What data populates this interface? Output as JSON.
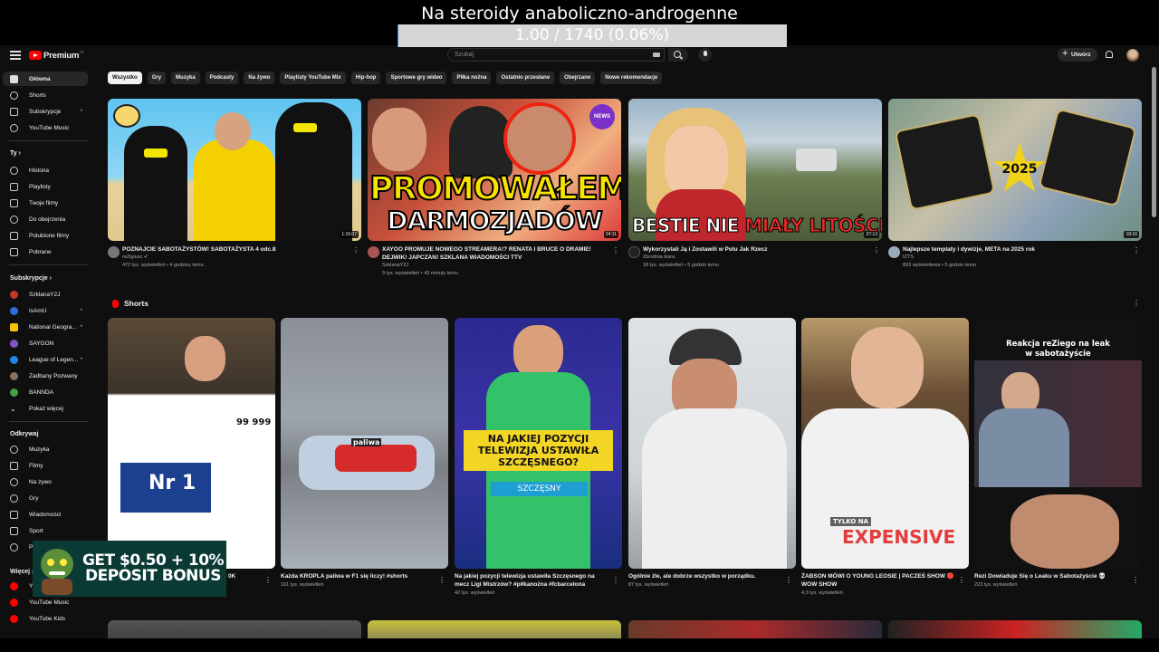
{
  "overlay": {
    "title": "Na steroidy anaboliczno-androgenne",
    "progress_text": "1.00 / 1740 (0.06%)",
    "progress_fraction": 0.0006
  },
  "header": {
    "logo_text": "Premium",
    "logo_sup": "PL",
    "search_placeholder": "Szukaj",
    "create_label": "Utwórz"
  },
  "sidebar": {
    "main": [
      {
        "label": "Główna"
      },
      {
        "label": "Shorts"
      },
      {
        "label": "Subskrypcje"
      },
      {
        "label": "YouTube Music"
      }
    ],
    "you_header": "Ty",
    "you": [
      {
        "label": "Historia"
      },
      {
        "label": "Playlisty"
      },
      {
        "label": "Twoje filmy"
      },
      {
        "label": "Do obejrzenia"
      },
      {
        "label": "Polubione filmy"
      },
      {
        "label": "Pobrane"
      }
    ],
    "subs_header": "Subskrypcje",
    "subs": [
      {
        "label": "SzklanaY2J"
      },
      {
        "label": "IsAmU"
      },
      {
        "label": "National Geogra..."
      },
      {
        "label": "SAYGON"
      },
      {
        "label": "League of Legen..."
      },
      {
        "label": "Zadbany Pozwany"
      },
      {
        "label": "BANNDA"
      },
      {
        "label": "Pokaż więcej"
      }
    ],
    "explore_header": "Odkrywaj",
    "explore": [
      {
        "label": "Muzyka"
      },
      {
        "label": "Filmy"
      },
      {
        "label": "Na żywo"
      },
      {
        "label": "Gry"
      },
      {
        "label": "Wiadomości"
      },
      {
        "label": "Sport"
      },
      {
        "label": "P"
      }
    ],
    "more_header": "Więcej z",
    "more": [
      {
        "label": "Y"
      },
      {
        "label": "YouTube Music"
      },
      {
        "label": "YouTube Kids"
      }
    ]
  },
  "chips": [
    "Wszystko",
    "Gry",
    "Muzyka",
    "Podcasty",
    "Na żywo",
    "Playlisty YouTube Mix",
    "Hip-hop",
    "Sportowe gry wideo",
    "Piłka nożna",
    "Ostatnio przesłane",
    "Obejrzane",
    "Nowe rekomendacje"
  ],
  "videos": [
    {
      "title": "POZNAJCIE SABOTAŻYSTÓW! SABOTAŻYSTA 4 odc.8",
      "channel": "reZigiusz ✔",
      "stats": "472 tys. wyświetleń • 4 godziny temu",
      "duration": "1:16:07",
      "thumb_text": ""
    },
    {
      "title": "XAYOO PROMUJE NOWEGO STREAMERA!? RENATA I BRUCE O DRAMIE! DEJWIK! JAPCZAN! SZKLANA WIADOMOŚCI TTV",
      "channel": "SzklanaY2J",
      "stats": "9 tys. wyświetleń • 43 minuty temu",
      "duration": "24:11",
      "thumb_text": "PROMOWAŁEM! DARMOZJADÓW"
    },
    {
      "title": "Wykorzystali Ją i Zostawili w Polu Jak Rzecz",
      "channel": "Zbrodnia ikara",
      "stats": "18 tys. wyświetleń • 5 godzin temu",
      "duration": "27:13",
      "thumb_text_a": "BESTIE NIE ",
      "thumb_text_b": "MIAŁY LITOŚCI"
    },
    {
      "title": "Najlepsze templaty i dywizje, META na 2025 rok",
      "channel": "IZTS",
      "stats": "893 wyświetlenia • 5 godzin temu",
      "duration": "18:16",
      "thumb_text": "2025"
    }
  ],
  "shorts_header": "Shorts",
  "shorts": [
    {
      "title": "K",
      "stats": "",
      "overlay_a": "99 999",
      "overlay_b": "Nr 1"
    },
    {
      "title": "Każda KROPLA paliwa w F1 się liczy! #shorts",
      "stats": "161 tys. wyświetleń",
      "overlay": "paliwa"
    },
    {
      "title": "Na jakiej pozycji telewizja ustawiła Szczęsnego na mecz Ligi Mistrzów? #piłkanożna #fcbarcelona",
      "stats": "42 tys. wyświetleń",
      "overlay": "NA JAKIEJ POZYCJI TELEWIZJA USTAWIŁA SZCZĘSNEGO?",
      "overlay_name": "SZCZĘSNY"
    },
    {
      "title": "Ogólnie źle, ale dobrze wszystko w porządku.",
      "stats": "87 tys. wyświetleń",
      "overlay": ""
    },
    {
      "title": "ŻABSON MÓWI O YOUNG LEOSIE | PACZEŚ SHOW 🔴 WOW SHOW",
      "stats": "4,3 tys. wyświetleń",
      "overlay": "TYLKO NA"
    },
    {
      "title": "Rezi Dowiaduje Się o Leaku w Sabotażyście 💀",
      "stats": "223 tys. wyświetleń",
      "overlay": "Reakcja reZiego na leak w sabotażyście"
    }
  ],
  "ad": {
    "text": "GET $0.50 + 10% DEPOSIT BONUS"
  },
  "shorts_partial": {
    "first_title_suffix": "0K"
  }
}
